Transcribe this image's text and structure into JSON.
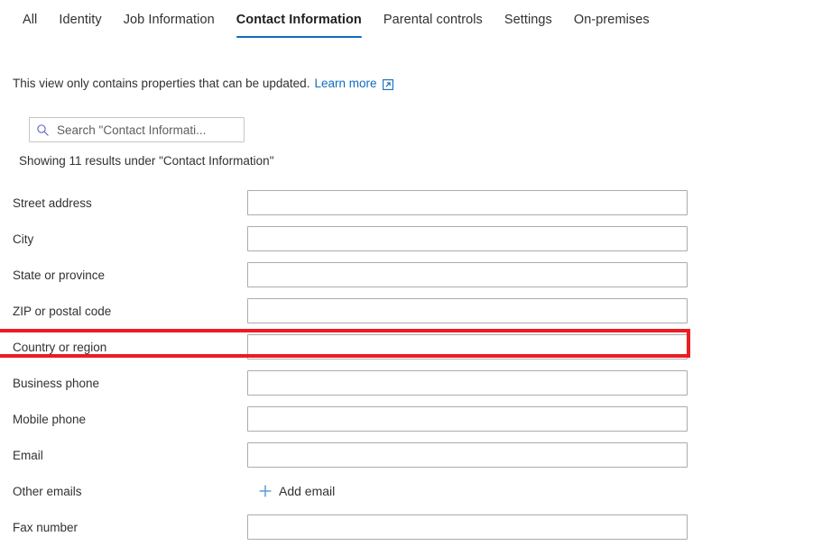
{
  "tabs": [
    {
      "label": "All",
      "selected": false
    },
    {
      "label": "Identity",
      "selected": false
    },
    {
      "label": "Job Information",
      "selected": false
    },
    {
      "label": "Contact Information",
      "selected": true
    },
    {
      "label": "Parental controls",
      "selected": false
    },
    {
      "label": "Settings",
      "selected": false
    },
    {
      "label": "On-premises",
      "selected": false
    }
  ],
  "notice": {
    "text": "This view only contains properties that can be updated.",
    "link_label": "Learn more",
    "link_icon": "external-link-icon"
  },
  "search": {
    "icon": "search-icon",
    "placeholder": "Search \"Contact Informati...",
    "value": ""
  },
  "results_caption": "Showing 11 results under \"Contact Information\"",
  "highlight_color": "#ec1c24",
  "accent_color": "#0f6cbd",
  "fields": [
    {
      "label": "Street address",
      "value": "",
      "type": "input",
      "highlighted": false
    },
    {
      "label": "City",
      "value": "",
      "type": "input",
      "highlighted": false
    },
    {
      "label": "State or province",
      "value": "",
      "type": "input",
      "highlighted": false
    },
    {
      "label": "ZIP or postal code",
      "value": "",
      "type": "input",
      "highlighted": false
    },
    {
      "label": "Country or region",
      "value": "",
      "type": "input",
      "highlighted": true
    },
    {
      "label": "Business phone",
      "value": "",
      "type": "input",
      "highlighted": false
    },
    {
      "label": "Mobile phone",
      "value": "",
      "type": "input",
      "highlighted": false
    },
    {
      "label": "Email",
      "value": "",
      "type": "input",
      "highlighted": false
    },
    {
      "label": "Other emails",
      "value": "",
      "type": "action",
      "action_label": "Add email",
      "action_icon": "plus-icon",
      "highlighted": false
    },
    {
      "label": "Fax number",
      "value": "",
      "type": "input",
      "highlighted": false
    }
  ]
}
